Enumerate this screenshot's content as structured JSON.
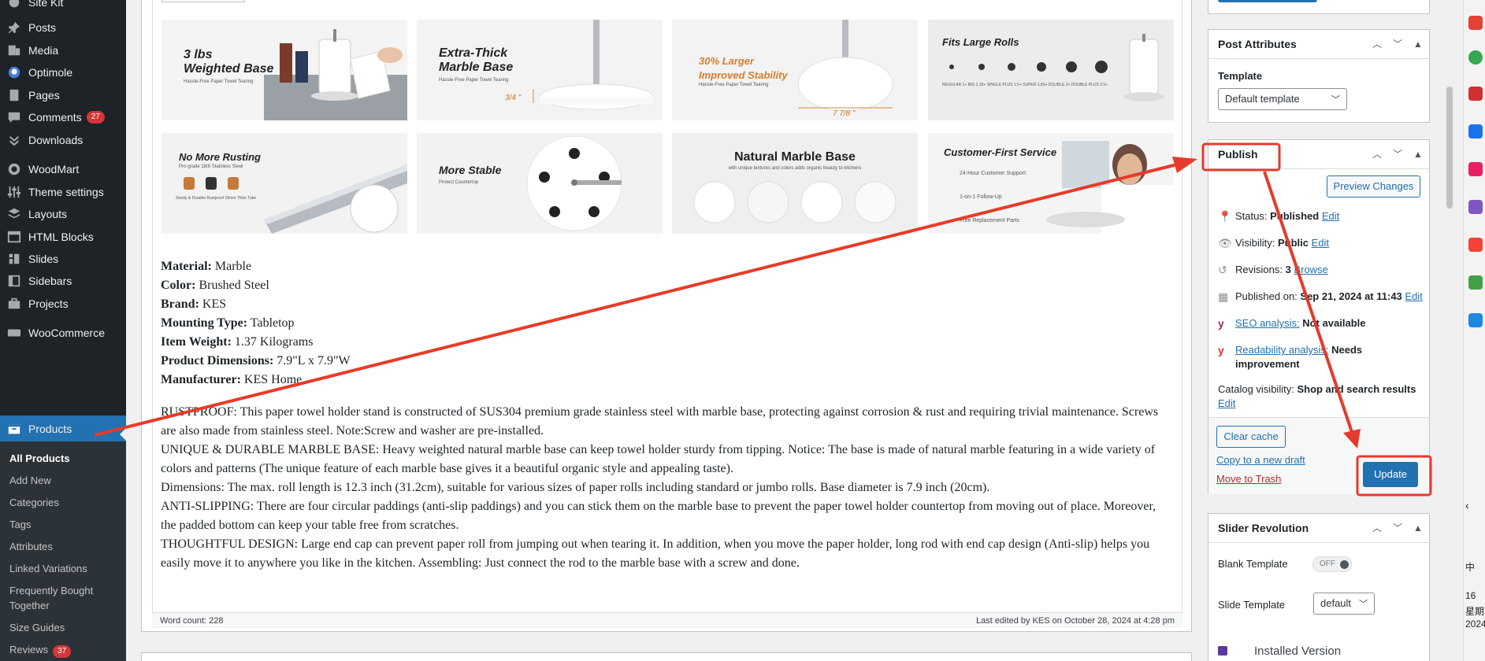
{
  "sidebar": {
    "items": [
      {
        "label": "Site Kit",
        "icon": "site-kit-icon"
      },
      {
        "label": "Posts",
        "icon": "pin-icon"
      },
      {
        "label": "Media",
        "icon": "media-icon"
      },
      {
        "label": "Optimole",
        "icon": "optimole-icon"
      },
      {
        "label": "Pages",
        "icon": "page-icon"
      },
      {
        "label": "Comments",
        "icon": "comment-icon",
        "badge": "27"
      },
      {
        "label": "Downloads",
        "icon": "download-icon"
      },
      {
        "label": "WoodMart",
        "icon": "woodmart-icon"
      },
      {
        "label": "Theme settings",
        "icon": "sliders-icon"
      },
      {
        "label": "Layouts",
        "icon": "layers-icon"
      },
      {
        "label": "HTML Blocks",
        "icon": "html-icon"
      },
      {
        "label": "Slides",
        "icon": "slides-icon"
      },
      {
        "label": "Sidebars",
        "icon": "sidebars-icon"
      },
      {
        "label": "Projects",
        "icon": "briefcase-icon"
      },
      {
        "label": "WooCommerce",
        "icon": "woo-icon"
      },
      {
        "label": "Products",
        "icon": "archive-icon"
      }
    ],
    "submenu": [
      {
        "label": "All Products",
        "current": true
      },
      {
        "label": "Add New"
      },
      {
        "label": "Categories"
      },
      {
        "label": "Tags"
      },
      {
        "label": "Attributes"
      },
      {
        "label": "Linked Variations"
      },
      {
        "label": "Frequently Bought Together"
      },
      {
        "label": "Size Guides"
      },
      {
        "label": "Reviews",
        "badge": "37"
      }
    ]
  },
  "tiles": [
    {
      "title": "3 lbs\nWeighted Base",
      "sub": "Hassle-Free Paper Towel Tearing"
    },
    {
      "title": "Extra-Thick\nMarble Base",
      "sub": "Hassle-Free Paper Towel Tearing",
      "extra": "3/4 \""
    },
    {
      "title": "30% Larger\nImproved Stability",
      "sub": "Hassle-Free Paper Towel Tearing",
      "extra": "7 7/8 \""
    },
    {
      "title": "Fits Large Rolls",
      "sub": "REGULAR 1+   BIG 1.33+   SINGLE PLUS 1.5+   SUPER 1.83+   DOUBLE 2+   DOUBLE PLUS 2.5+"
    },
    {
      "title": "No More Rusting",
      "sub": "Pro-grade 18/8 Stainless Steel",
      "extra": "Sturdy & Durable   Rustproof   18mm Thick Tube"
    },
    {
      "title": "More Stable",
      "sub": "Protect Countertop"
    },
    {
      "title": "Natural Marble Base",
      "sub": "with unique textures and colors adds organic beauty to kitchens"
    },
    {
      "title": "Customer-First Service",
      "sub": "24-Hour Customer Support",
      "extra": "1-on-1 Follow-Up",
      "extra2": "Free Replacement Parts"
    }
  ],
  "specs": [
    {
      "label": "Material:",
      "value": " Marble"
    },
    {
      "label": "Color:",
      "value": " Brushed Steel"
    },
    {
      "label": "Brand:",
      "value": " KES"
    },
    {
      "label": "Mounting Type:",
      "value": " Tabletop"
    },
    {
      "label": "Item Weight:",
      "value": " 1.37 Kilograms"
    },
    {
      "label": "Product Dimensions:",
      "value": " 7.9\"L x 7.9\"W"
    },
    {
      "label": "Manufacturer:",
      "value": " KES Home"
    }
  ],
  "paragraphs": [
    "RUSTPROOF: This paper towel holder stand is constructed of SUS304 premium grade stainless steel with marble base, protecting against corrosion & rust and requiring trivial maintenance. Screws are also made from stainless steel. Note:Screw and washer are pre-installed.",
    "UNIQUE & DURABLE MARBLE BASE: Heavy weighted natural marble base can keep towel holder sturdy from tipping. Notice: The base is made of natural marble featuring in a wide variety of colors and patterns (The unique feature of each marble base gives it a beautiful organic style and appealing taste).",
    "Dimensions: The max. roll length is 12.3 inch (31.2cm), suitable for various sizes of paper rolls including standard or jumbo rolls. Base diameter is 7.9 inch (20cm).",
    "ANTI-SLIPPING: There are four circular paddings (anti-slip paddings) and you can stick them on the marble base to prevent the paper towel holder countertop from moving out of place. Moreover, the padded bottom can keep your table free from scratches.",
    "THOUGHTFUL DESIGN: Large end cap can prevent paper roll from jumping out when tearing it. In addition, when you move the paper holder, long rod with end cap design (Anti-slip) helps you easily move it to anywhere you like in the kitchen. Assembling: Just connect the rod to the marble base with a screw and done."
  ],
  "status": {
    "word_count": "Word count: 228",
    "last_edited": "Last edited by KES on October 28, 2024 at 4:28 pm"
  },
  "post_attributes": {
    "title": "Post Attributes",
    "template_label": "Template",
    "template_value": "Default template"
  },
  "publish": {
    "title": "Publish",
    "preview": "Preview Changes",
    "status_label": "Status:",
    "status_value": "Published",
    "visibility_label": "Visibility:",
    "visibility_value": "Public",
    "revisions_label": "Revisions:",
    "revisions_value": "3",
    "revisions_link": "Browse",
    "published_label": "Published on:",
    "published_value": "Sep 21, 2024 at 11:43",
    "edit": "Edit",
    "seo_link": "SEO analysis:",
    "seo_value": "Not available",
    "read_link": "Readability analysis:",
    "read_value": "Needs improvement",
    "catalog_label": "Catalog visibility:",
    "catalog_value": "Shop and search results",
    "clear_cache": "Clear cache",
    "copy_draft": "Copy to a new draft",
    "trash": "Move to Trash",
    "update": "Update"
  },
  "slider": {
    "title": "Slider Revolution",
    "blank_label": "Blank Template",
    "toggle": "OFF",
    "slide_label": "Slide Template",
    "slide_value": "default",
    "installed": "Installed Version"
  },
  "os": {
    "time": "16",
    "day": "星期",
    "date": "2024-",
    "ime": "中"
  },
  "colors": {
    "sidebar_bg": "#1d2327",
    "accent": "#2271b1",
    "annotation": "#e53b2c",
    "badge": "#d63638"
  }
}
